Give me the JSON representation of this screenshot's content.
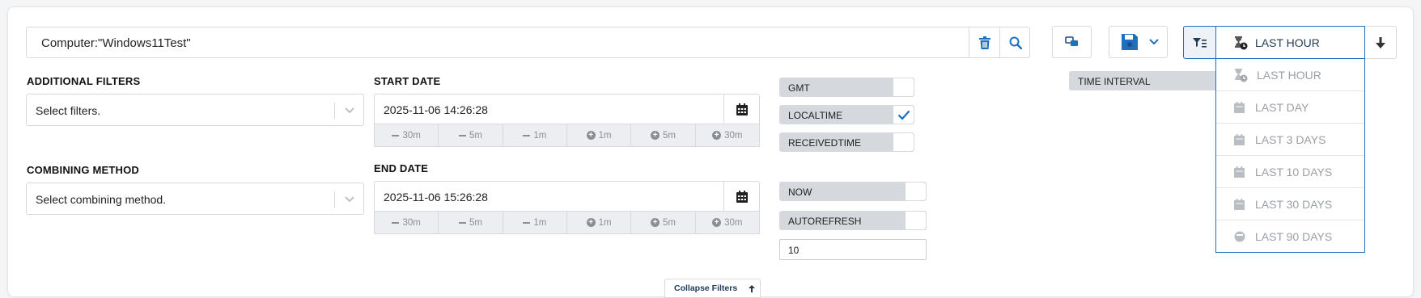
{
  "search": {
    "value": "Computer:\"Windows11Test\""
  },
  "filters": {
    "additional_label": "ADDITIONAL FILTERS",
    "additional_placeholder": "Select filters.",
    "combining_label": "COMBINING METHOD",
    "combining_placeholder": "Select combining method."
  },
  "start": {
    "label": "START DATE",
    "value": "2025-11-06 14:26:28",
    "steps": [
      "30m",
      "5m",
      "1m",
      "1m",
      "5m",
      "30m"
    ]
  },
  "end": {
    "label": "END DATE",
    "value": "2025-11-06 15:26:28",
    "steps": [
      "30m",
      "5m",
      "1m",
      "1m",
      "5m",
      "30m"
    ]
  },
  "toggles": {
    "gmt": "GMT",
    "localtime": "LOCALTIME",
    "receivedtime": "RECEIVEDTIME",
    "now": "NOW",
    "autorefresh": "AUTOREFRESH",
    "time_interval": "TIME INTERVAL"
  },
  "states": {
    "gmt": false,
    "localtime": true,
    "receivedtime": false,
    "now": false,
    "autorefresh": false
  },
  "refresh_value": "10",
  "time_range": {
    "selected": "LAST HOUR",
    "options": [
      "LAST HOUR",
      "LAST DAY",
      "LAST 3 DAYS",
      "LAST 10 DAYS",
      "LAST 30 DAYS",
      "LAST 90 DAYS"
    ]
  },
  "collapse_label": "Collapse Filters",
  "colors": {
    "accent": "#1f6fbf",
    "toggle_bg": "#d5d8dd",
    "muted": "#9aa0a7"
  }
}
